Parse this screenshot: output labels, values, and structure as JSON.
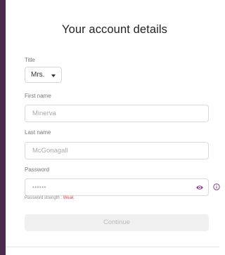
{
  "form": {
    "heading": "Your account details",
    "title_label": "Title",
    "title_value": "Mrs.",
    "first_name_label": "First name",
    "first_name_placeholder": "Minerva",
    "last_name_label": "Last name",
    "last_name_placeholder": "McGonagall",
    "password_label": "Password",
    "password_placeholder": "••••••",
    "strength_prefix": "Password strength : ",
    "strength_value": "Weak",
    "continue_label": "Continue"
  },
  "colors": {
    "accent": "#4a2a4d",
    "eye_icon": "#8a3d8f",
    "weak": "#e0444f",
    "button_bg": "#f0f0f0",
    "button_text": "#bbbbbb"
  },
  "icons": [
    "eye-icon",
    "info-icon",
    "chevron-down-icon"
  ]
}
